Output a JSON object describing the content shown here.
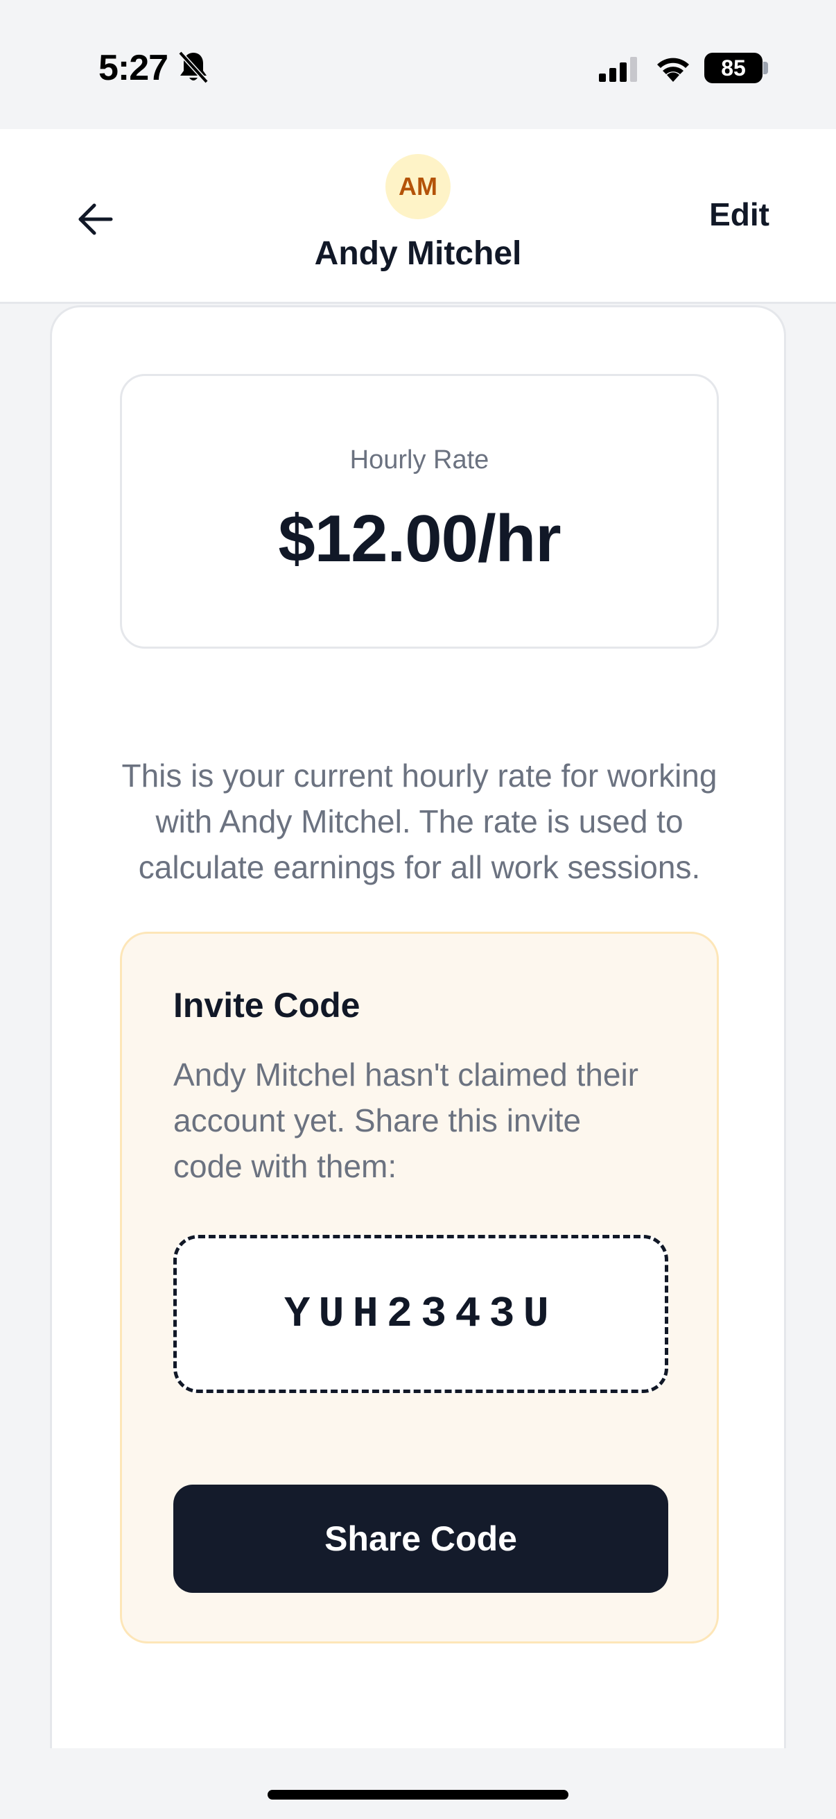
{
  "status_bar": {
    "time": "5:27",
    "battery": "85"
  },
  "header": {
    "avatar_initials": "AM",
    "name": "Andy Mitchel",
    "edit_label": "Edit"
  },
  "rate": {
    "label": "Hourly Rate",
    "value": "$12.00/hr",
    "description": "This is your current hourly rate for working with Andy Mitchel. The rate is used to calculate earnings for all work sessions."
  },
  "invite": {
    "title": "Invite Code",
    "text": "Andy Mitchel hasn't claimed their account yet. Share this invite code with them:",
    "code": "YUH2343U",
    "share_label": "Share Code"
  },
  "colors": {
    "primary_dark": "#141b2b",
    "invite_bg": "#fdf7ee",
    "avatar_bg": "#fef3c7",
    "avatar_text": "#b45309"
  },
  "icons": {
    "back": "arrow-left-icon",
    "silent": "bell-slash-icon",
    "signal": "cellular-signal-icon",
    "wifi": "wifi-icon",
    "battery": "battery-icon"
  }
}
